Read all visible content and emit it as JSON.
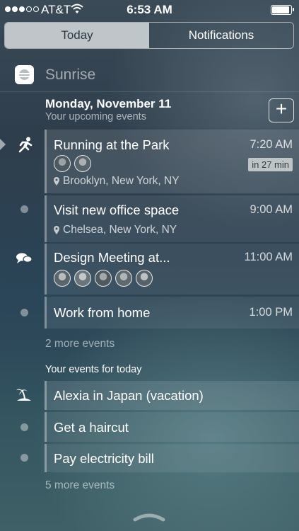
{
  "status_bar": {
    "carrier": "AT&T",
    "time": "6:53 AM",
    "signal_bars": 5,
    "signal_filled": 3,
    "battery_level": 0.9
  },
  "tabs": [
    {
      "label": "Today",
      "active": true
    },
    {
      "label": "Notifications",
      "active": false
    }
  ],
  "widget": {
    "app_name": "Sunrise",
    "date_title": "Monday, November 11",
    "date_subtitle": "Your upcoming events",
    "add_label": "+",
    "events": [
      {
        "title": "Running at the Park",
        "time": "7:20 AM",
        "badge": "in 27 min",
        "location": "Brooklyn, New York, NY",
        "attendees": 2,
        "icon": "running-icon"
      },
      {
        "title": "Visit new office space",
        "time": "9:00 AM",
        "location": "Chelsea, New York, NY",
        "icon": "dot"
      },
      {
        "title": "Design Meeting at...",
        "time": "11:00 AM",
        "attendees": 5,
        "icon": "chat-bubbles-icon"
      },
      {
        "title": "Work from home",
        "time": "1:00 PM",
        "icon": "dot"
      }
    ],
    "more_upcoming": "2 more events",
    "today_section_title": "Your events for today",
    "today_events": [
      {
        "title": "Alexia in Japan (vacation)",
        "icon": "palm-tree-island-icon"
      },
      {
        "title": "Get a haircut",
        "icon": "dot"
      },
      {
        "title": "Pay electricity bill",
        "icon": "dot"
      }
    ],
    "more_today": "5 more events"
  }
}
